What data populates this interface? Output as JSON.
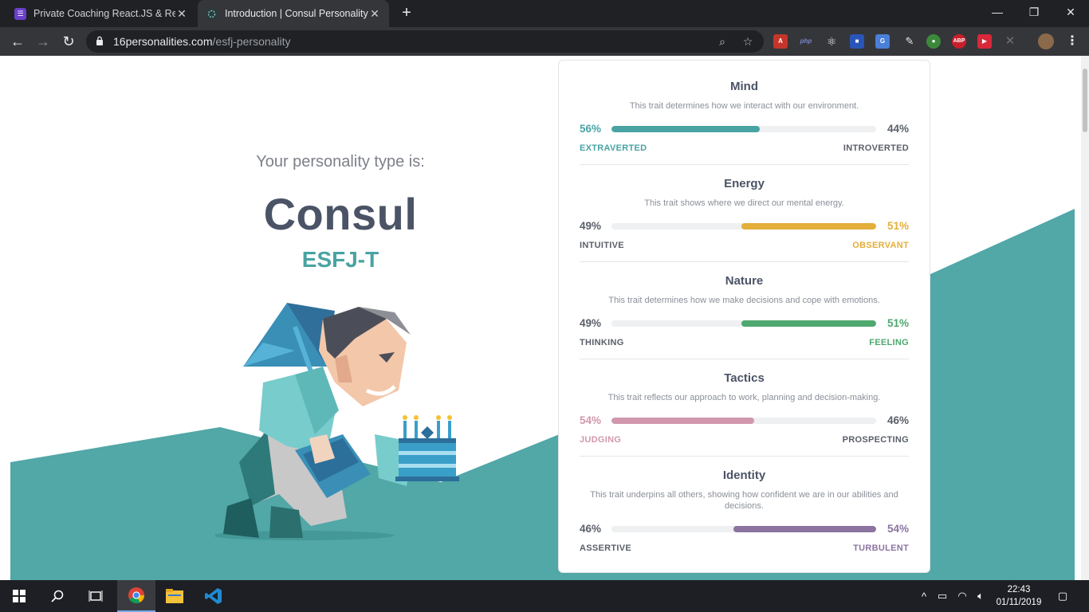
{
  "browser": {
    "tabs": [
      {
        "title": "Private Coaching React.JS & React",
        "active": false
      },
      {
        "title": "Introduction | Consul Personality",
        "active": true
      }
    ],
    "url_domain": "16personalities.com",
    "url_path": "/esfj-personality",
    "extensions": [
      "pdf-icon",
      "php-icon",
      "react-icon",
      "square-icon",
      "translate-icon",
      "pen-icon",
      "puzzle-icon",
      "abp-icon",
      "video-icon",
      "x-icon",
      "avatar"
    ]
  },
  "hero": {
    "subtitle": "Your personality type is:",
    "type_name": "Consul",
    "type_code": "ESFJ-T"
  },
  "traits": [
    {
      "name": "Mind",
      "description": "This trait determines how we interact with our environment.",
      "left_pct": "56%",
      "right_pct": "44%",
      "left_label": "EXTRAVERTED",
      "right_label": "INTROVERTED",
      "dominant": "left",
      "value": 0.56,
      "color": "#4aa3a3"
    },
    {
      "name": "Energy",
      "description": "This trait shows where we direct our mental energy.",
      "left_pct": "49%",
      "right_pct": "51%",
      "left_label": "INTUITIVE",
      "right_label": "OBSERVANT",
      "dominant": "right",
      "value": 0.51,
      "color": "#e4ae3a"
    },
    {
      "name": "Nature",
      "description": "This trait determines how we make decisions and cope with emotions.",
      "left_pct": "49%",
      "right_pct": "51%",
      "left_label": "THINKING",
      "right_label": "FEELING",
      "dominant": "right",
      "value": 0.51,
      "color": "#4ea86f"
    },
    {
      "name": "Tactics",
      "description": "This trait reflects our approach to work, planning and decision-making.",
      "left_pct": "54%",
      "right_pct": "46%",
      "left_label": "JUDGING",
      "right_label": "PROSPECTING",
      "dominant": "left",
      "value": 0.54,
      "color": "#d198ad"
    },
    {
      "name": "Identity",
      "description": "This trait underpins all others, showing how confident we are in our abilities and decisions.",
      "left_pct": "46%",
      "right_pct": "54%",
      "left_label": "ASSERTIVE",
      "right_label": "TURBULENT",
      "dominant": "right",
      "value": 0.54,
      "color": "#8b74a0"
    }
  ],
  "taskbar": {
    "time": "22:43",
    "date": "01/11/2019"
  },
  "colors": {
    "teal_bg": "#52a7a7",
    "text_dark": "#4b5466",
    "neutral_text": "#5a5f69"
  }
}
